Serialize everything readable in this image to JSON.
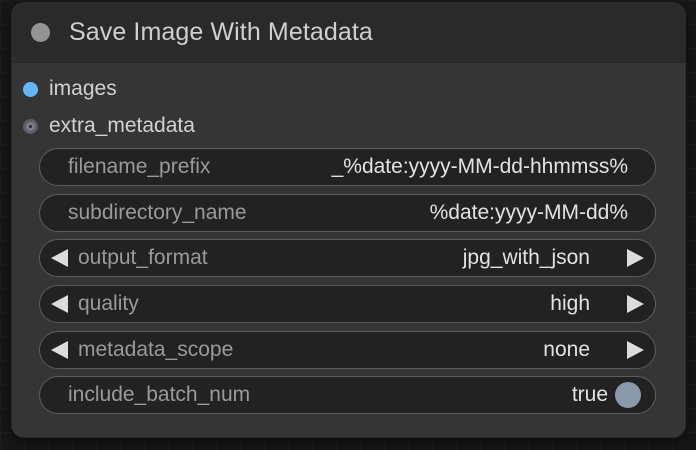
{
  "node": {
    "title": "Save Image With Metadata",
    "inputs": [
      {
        "label": "images",
        "color": "#64b5f6"
      },
      {
        "label": "extra_metadata",
        "color": "#7d7d8c"
      }
    ],
    "widgets": {
      "filename_prefix": {
        "label": "filename_prefix",
        "value": "_%date:yyyy-MM-dd-hhmmss%"
      },
      "subdirectory_name": {
        "label": "subdirectory_name",
        "value": "%date:yyyy-MM-dd%"
      },
      "output_format": {
        "label": "output_format",
        "value": "jpg_with_json"
      },
      "quality": {
        "label": "quality",
        "value": "high"
      },
      "metadata_scope": {
        "label": "metadata_scope",
        "value": "none"
      },
      "include_batch_num": {
        "label": "include_batch_num",
        "value": "true"
      }
    }
  }
}
